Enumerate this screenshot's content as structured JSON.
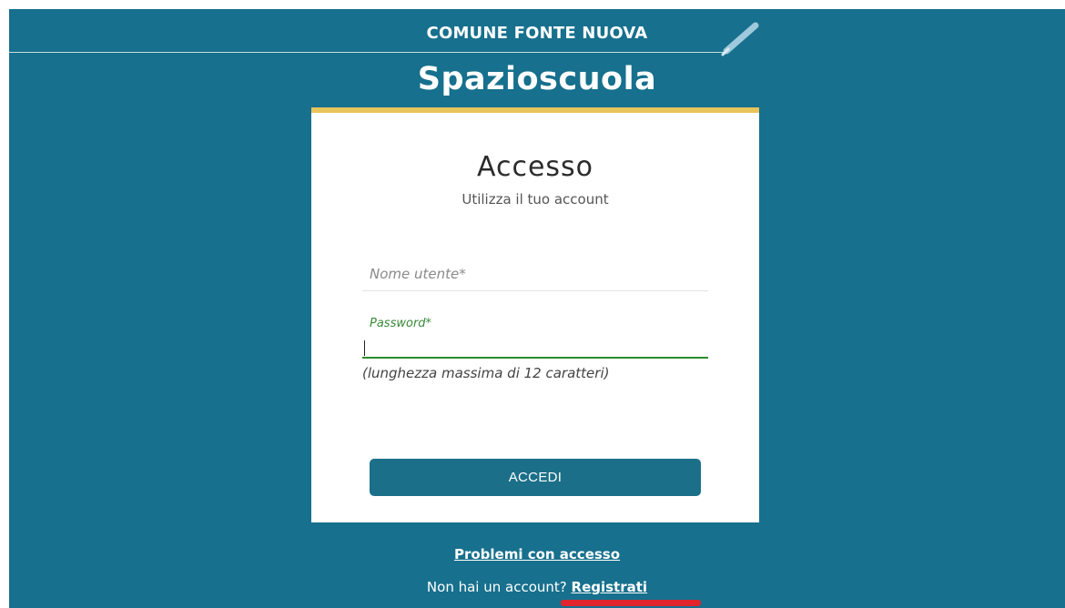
{
  "header": {
    "brand": "COMUNE FONTE NUOVA",
    "app_title": "Spazioscuola"
  },
  "login": {
    "heading": "Accesso",
    "subtitle": "Utilizza il tuo account",
    "username": {
      "placeholder": "Nome utente*",
      "value": ""
    },
    "password": {
      "label": "Password*",
      "value": "",
      "hint": "(lunghezza massima di 12 caratteri)"
    },
    "submit_label": "ACCEDI"
  },
  "footer": {
    "problems_link": "Problemi con accesso",
    "register_prompt": "Non hai un account?",
    "register_link": "Registrati"
  },
  "colors": {
    "background": "#17708d",
    "card_accent": "#e8c45c",
    "button": "#1b6f89",
    "focus_green": "#2e8b2e",
    "highlight": "#e0252c"
  },
  "icons": [
    "pencil-icon"
  ]
}
